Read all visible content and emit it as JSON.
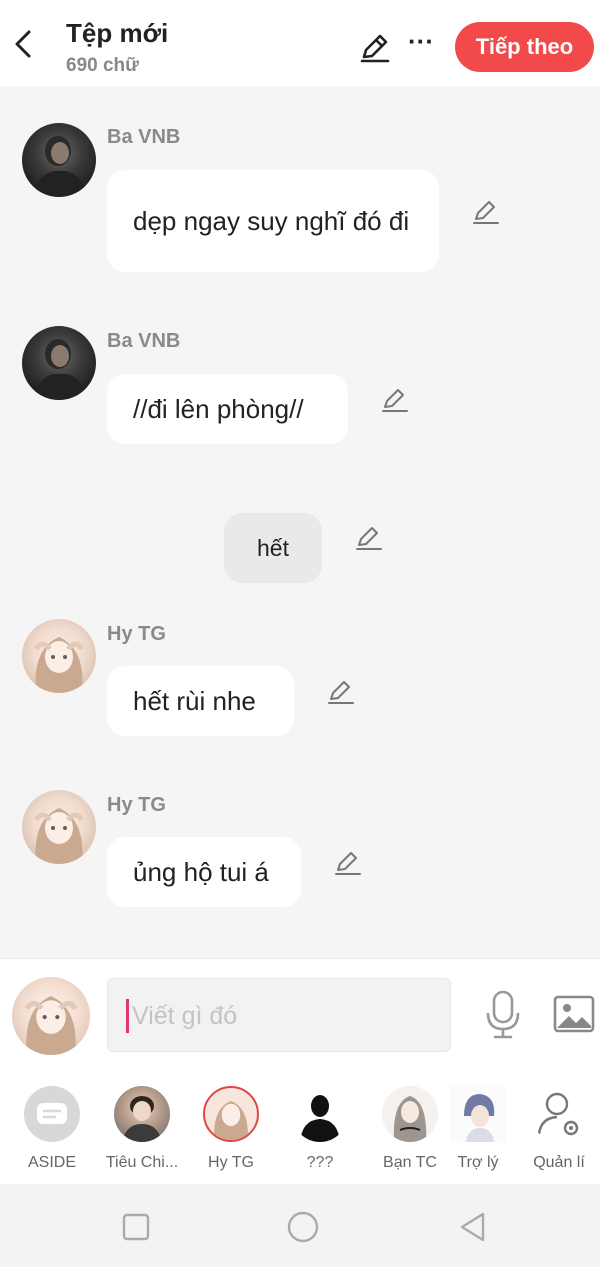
{
  "header": {
    "title": "Tệp mới",
    "subtitle": "690 chữ",
    "more_label": "···",
    "next_label": "Tiếp theo"
  },
  "messages": [
    {
      "sender": "Ba VNB",
      "text": "dẹp ngay suy nghĩ đó đi"
    },
    {
      "sender": "Ba VNB",
      "text": "//đi lên phòng//"
    },
    {
      "sender": "",
      "text": "hết"
    },
    {
      "sender": "Hy TG",
      "text": "hết rùi nhe"
    },
    {
      "sender": "Hy TG",
      "text": "ủng hộ tui á"
    }
  ],
  "composer": {
    "placeholder": "Viết gì đó"
  },
  "characters": [
    {
      "label": "ASIDE"
    },
    {
      "label": "Tiêu Chi..."
    },
    {
      "label": "Hy TG"
    },
    {
      "label": "???"
    },
    {
      "label": "Bạn TC"
    },
    {
      "label": "Trợ lý"
    },
    {
      "label": "Quản lí"
    }
  ],
  "colors": {
    "accent": "#f24a4a",
    "caret": "#e2366f",
    "background": "#f5f5f5",
    "bubble": "#ffffff",
    "narration_bubble": "#e9e9e9"
  },
  "icons": [
    "back-arrow-icon",
    "pencil-icon",
    "more-icon",
    "microphone-icon",
    "image-icon",
    "user-settings-icon",
    "square-icon",
    "circle-icon",
    "triangle-back-icon"
  ]
}
